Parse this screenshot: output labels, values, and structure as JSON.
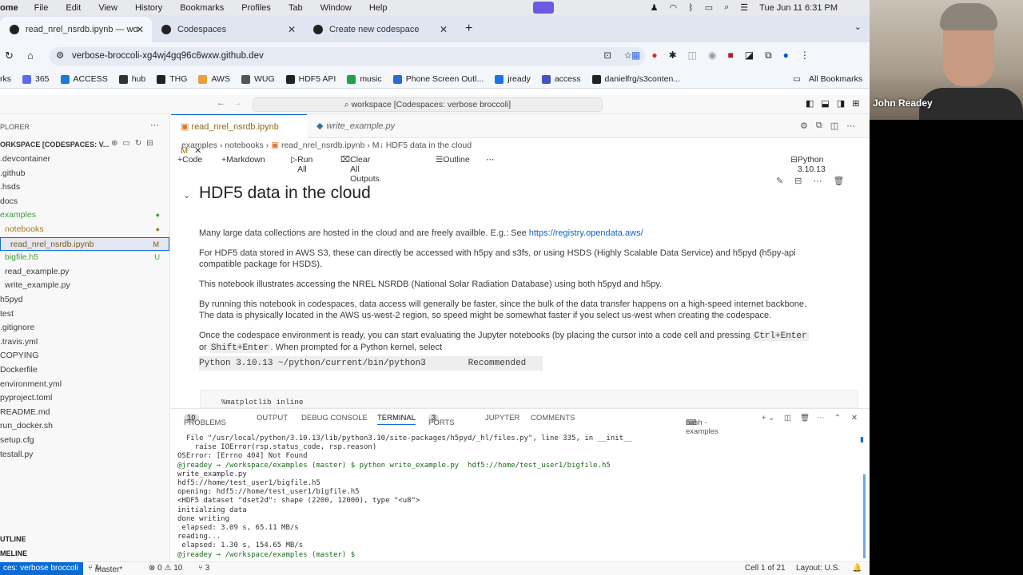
{
  "menubar": {
    "app": "ome",
    "items": [
      "File",
      "Edit",
      "View",
      "History",
      "Bookmarks",
      "Profiles",
      "Tab",
      "Window",
      "Help"
    ],
    "clock": "Tue Jun 11  6:31 PM"
  },
  "browser": {
    "tabs": [
      {
        "title": "read_nrel_nsrdb.ipynb — wo"
      },
      {
        "title": "Codespaces"
      },
      {
        "title": "Create new codespace"
      }
    ],
    "url": "verbose-broccoli-xg4wj4gq96c6wxw.github.dev",
    "bookmarks": [
      {
        "label": "rks",
        "color": "#555"
      },
      {
        "label": "365",
        "color": "#5b6cf0"
      },
      {
        "label": "ACCESS",
        "color": "#1b7bd8"
      },
      {
        "label": "hub",
        "color": "#333"
      },
      {
        "label": "THG",
        "color": "#222"
      },
      {
        "label": "AWS",
        "color": "#e8a13a"
      },
      {
        "label": "WUG",
        "color": "#555"
      },
      {
        "label": "HDF5 API",
        "color": "#222"
      },
      {
        "label": "music",
        "color": "#25a04a"
      },
      {
        "label": "Phone Screen Outl...",
        "color": "#2c6bd6"
      },
      {
        "label": "jready",
        "color": "#1a73e8"
      },
      {
        "label": "access",
        "color": "#4155c4"
      },
      {
        "label": "danielfrg/s3conten...",
        "color": "#222"
      }
    ],
    "all_bookmarks": "All Bookmarks"
  },
  "vscode": {
    "command_center": "workspace [Codespaces: verbose broccoli]"
  },
  "explorer": {
    "title": "PLORER",
    "root": "ORKSPACE [CODESPACES: V...",
    "items": [
      {
        "label": ".devcontainer",
        "indent": 2,
        "color": "#3b3b3b",
        "badge": ""
      },
      {
        "label": ".github",
        "indent": 2,
        "color": "#3b3b3b",
        "badge": ""
      },
      {
        "label": ".hsds",
        "indent": 2,
        "color": "#3b3b3b",
        "badge": ""
      },
      {
        "label": "docs",
        "indent": 2,
        "color": "#3b3b3b",
        "badge": ""
      },
      {
        "label": "examples",
        "indent": 2,
        "color": "#3f9f3f",
        "badge": "●"
      },
      {
        "label": "notebooks",
        "indent": 8,
        "color": "#a37a1f",
        "badge": "●"
      },
      {
        "label": "read_nrel_nsrdb.ipynb",
        "indent": 14,
        "color": "#7a5a10",
        "badge": "M"
      },
      {
        "label": "bigfile.h5",
        "indent": 8,
        "color": "#3f9f3f",
        "badge": "U"
      },
      {
        "label": "read_example.py",
        "indent": 8,
        "color": "#3b3b3b",
        "badge": ""
      },
      {
        "label": "write_example.py",
        "indent": 8,
        "color": "#3b3b3b",
        "badge": ""
      },
      {
        "label": "h5pyd",
        "indent": 2,
        "color": "#3b3b3b",
        "badge": ""
      },
      {
        "label": "test",
        "indent": 2,
        "color": "#3b3b3b",
        "badge": ""
      },
      {
        "label": ".gitignore",
        "indent": 2,
        "color": "#3b3b3b",
        "badge": ""
      },
      {
        "label": ".travis.yml",
        "indent": 2,
        "color": "#3b3b3b",
        "badge": ""
      },
      {
        "label": "COPYING",
        "indent": 2,
        "color": "#3b3b3b",
        "badge": ""
      },
      {
        "label": "Dockerfile",
        "indent": 2,
        "color": "#3b3b3b",
        "badge": ""
      },
      {
        "label": "environment.yml",
        "indent": 2,
        "color": "#3b3b3b",
        "badge": ""
      },
      {
        "label": "pyproject.toml",
        "indent": 2,
        "color": "#3b3b3b",
        "badge": ""
      },
      {
        "label": "README.md",
        "indent": 2,
        "color": "#3b3b3b",
        "badge": ""
      },
      {
        "label": "run_docker.sh",
        "indent": 2,
        "color": "#3b3b3b",
        "badge": ""
      },
      {
        "label": "setup.cfg",
        "indent": 2,
        "color": "#3b3b3b",
        "badge": ""
      },
      {
        "label": "testall.py",
        "indent": 2,
        "color": "#3b3b3b",
        "badge": ""
      }
    ],
    "outline": "UTLINE",
    "timeline": "MELINE"
  },
  "editor": {
    "tabs": [
      {
        "label": "read_nrel_nsrdb.ipynb",
        "badge": "M"
      },
      {
        "label": "write_example.py"
      }
    ],
    "breadcrumb": [
      "examples",
      "notebooks",
      "read_nrel_nsrdb.ipynb",
      "M↓ HDF5 data in the cloud"
    ],
    "toolbar": {
      "code": "Code",
      "markdown": "Markdown",
      "run_all": "Run All",
      "clear": "Clear All Outputs",
      "outline": "Outline",
      "kernel": "Python 3.10.13"
    },
    "heading": "HDF5 data in the cloud",
    "p1": "Many large data collections are hosted in the cloud and are freely availble. E.g.: See ",
    "p1_link": "https://registry.opendata.aws/",
    "p2a": "For HDF5 data stored in AWS S3, these can directly be accessed with h5py and s3fs, or using HSDS (Highly Scalable Data Service) and h5pyd (h5py-api",
    "p2b": "compatible package for HSDS).",
    "p3": "This notebook illustrates accessing the NREL NSRDB (National Solar Radiation Database) using both h5pyd and h5py.",
    "p4a": "By running this notebook in codespaces, data access will generally be faster, since the bulk of the data transfer happens on a high-speed internet backbone.",
    "p4b": "The data is physically located in the AWS us-west-2 region, so speed might be somewhat faster if you select us-west when creating the codespace.",
    "p5a": "Once the codespace environment is ready, you can start evaluating the Jupyter notebooks (by placing the cursor into a code cell and pressing ",
    "p5_key1": "Ctrl+Enter",
    "p5_or": "or ",
    "p5_key2": "Shift+Enter",
    "p5b": ". When prompted for a Python kernel, select",
    "kernel_line": "Python 3.10.13 ~/python/current/bin/python3        Recommended",
    "code_line": "%matplotlib inline"
  },
  "panel": {
    "tabs": [
      {
        "label": "PROBLEMS",
        "count": "10"
      },
      {
        "label": "OUTPUT"
      },
      {
        "label": "DEBUG CONSOLE"
      },
      {
        "label": "TERMINAL"
      },
      {
        "label": "PORTS",
        "count": "3"
      },
      {
        "label": "JUPYTER"
      },
      {
        "label": "COMMENTS"
      }
    ],
    "shell": "bash - examples",
    "terminal": [
      "  File \"/usr/local/python/3.10.13/lib/python3.10/site-packages/h5pyd/_hl/files.py\", line 335, in __init__",
      "    raise IOError(rsp.status_code, rsp.reason)",
      "OSError: [Errno 404] Not Found",
      "@jreadey → /workspace/examples (master) $ python write_example.py  hdf5://home/test_user1/bigfile.h5",
      "write_example.py",
      "hdf5://home/test_user1/bigfile.h5",
      "opening: hdf5://home/test_user1/bigfile.h5",
      "<HDF5 dataset \"dset2d\": shape (2200, 12000), type \"<u8\">",
      "initialzing data",
      "done writing",
      " elapsed: 3.09 s, 65.11 MB/s",
      "reading...",
      " elapsed: 1.30 s, 154.65 MB/s",
      "@jreadey → /workspace/examples (master) $ "
    ]
  },
  "status": {
    "remote": "ces: verbose broccoli",
    "branch": "master*",
    "problems": "⊗ 0 ⚠ 10",
    "ports": "⑂ 3",
    "cell": "Cell 1 of 21",
    "layout": "Layout: U.S."
  },
  "video": {
    "name": "John Readey"
  }
}
